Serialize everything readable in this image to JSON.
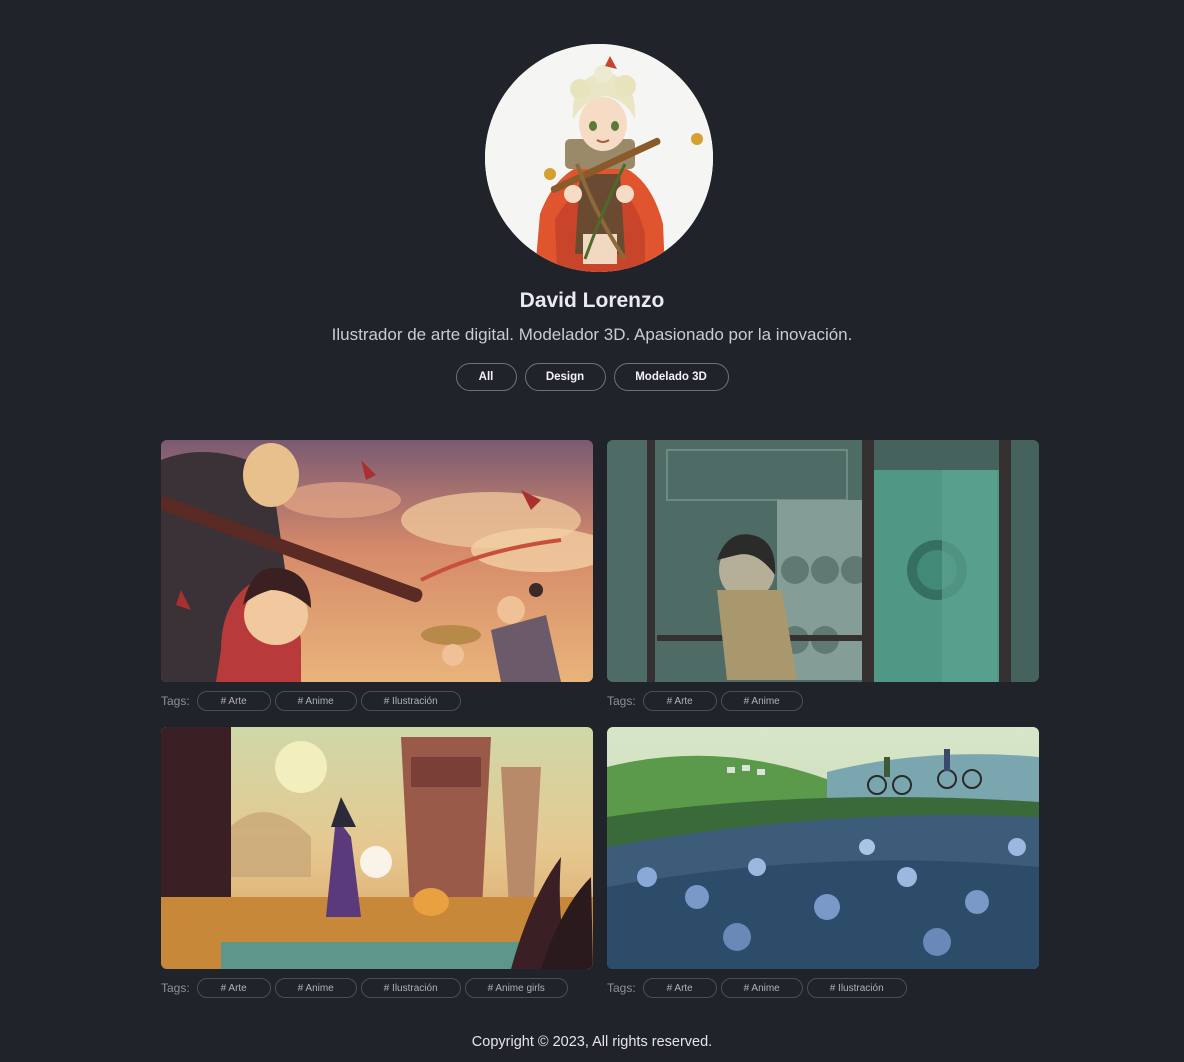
{
  "profile": {
    "name": "David Lorenzo",
    "bio": "Ilustrador de arte digital. Modelador 3D. Apasionado por la inovación.",
    "avatar_icon": "anime-character-avatar"
  },
  "filters": [
    {
      "label": "All"
    },
    {
      "label": "Design"
    },
    {
      "label": "Modelado 3D"
    }
  ],
  "gallery": {
    "tags_label": "Tags:",
    "cards": [
      {
        "image": "samurai-and-children-illustration",
        "tags": [
          "# Arte",
          "# Anime",
          "# Ilustración"
        ]
      },
      {
        "image": "laundromat-girl-illustration",
        "tags": [
          "# Arte",
          "# Anime"
        ]
      },
      {
        "image": "witch-in-desert-ruins-illustration",
        "tags": [
          "# Arte",
          "# Anime",
          "# Ilustración",
          "# Anime girls"
        ]
      },
      {
        "image": "cyclists-in-flower-field-illustration",
        "tags": [
          "# Arte",
          "# Anime",
          "# Ilustración"
        ]
      }
    ]
  },
  "footer": {
    "copyright": "Copyright © 2023, All rights reserved."
  }
}
